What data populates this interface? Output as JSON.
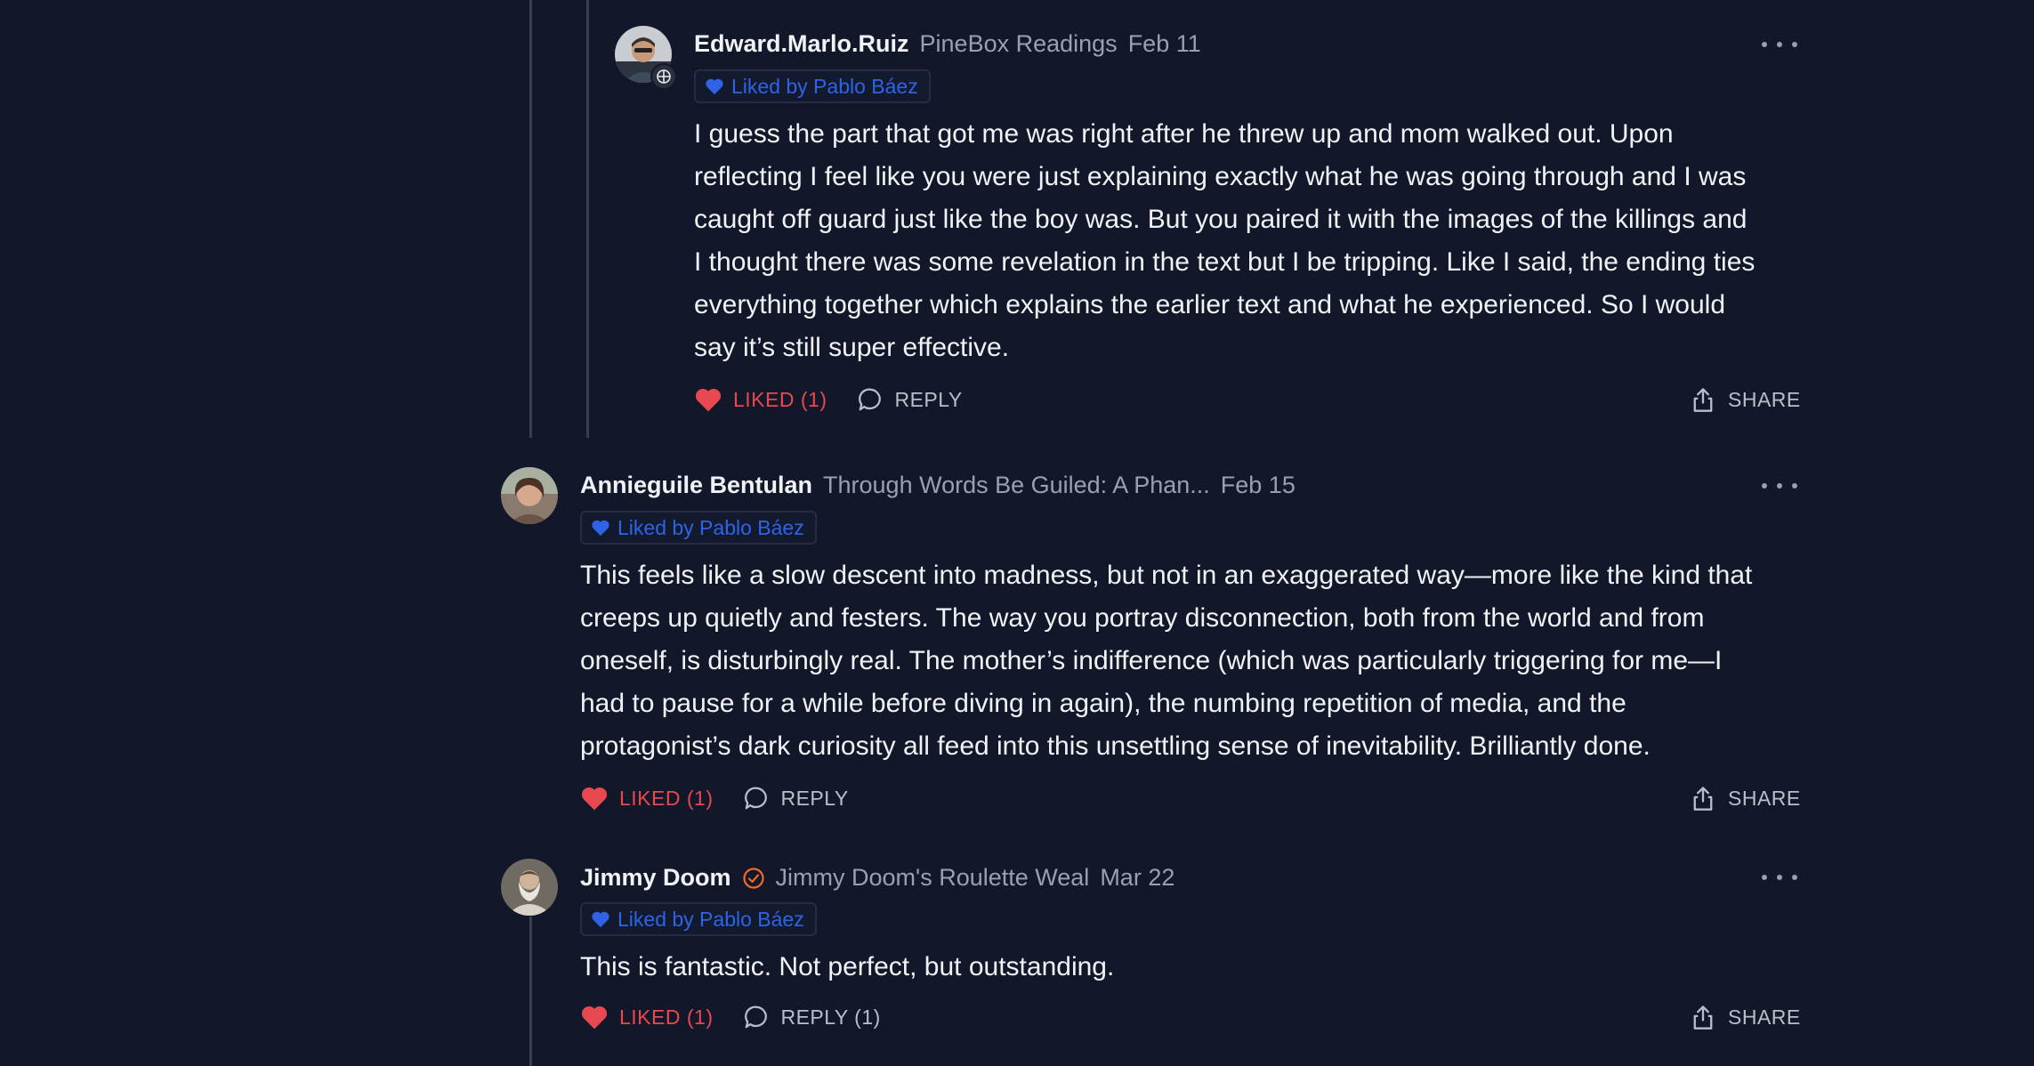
{
  "colors": {
    "background": "#121829",
    "liked_red": "#e8484f",
    "badge_blue": "#2e63e8",
    "verified_orange": "#f06a2a"
  },
  "comments": [
    {
      "author": "Edward.Marlo.Ruiz",
      "publication": "PineBox Readings",
      "date": "Feb 11",
      "liked_by": "Liked by Pablo Báez",
      "lines": [
        "I guess the part that got me was right after he threw up and mom walked out. Upon",
        "reflecting I feel like you were just explaining exactly what he was going through and I was",
        "caught off guard just like the boy was. But you paired it with the images of the killings and",
        "I thought there was some revelation in the text but I be tripping. Like I said, the ending ties",
        "everything together which explains the earlier text and what he experienced. So I would",
        "say it’s still super effective."
      ],
      "like_label": "LIKED (1)",
      "reply_label": "REPLY",
      "share_label": "SHARE",
      "avatar_icon": "user-avatar-with-badge"
    },
    {
      "author": "Annieguile Bentulan",
      "publication": "Through Words Be Guiled: A Phan...",
      "date": "Feb 15",
      "liked_by": "Liked by Pablo Báez",
      "lines": [
        "This feels like a slow descent into madness, but not in an exaggerated way—more like the kind that",
        "creeps up quietly and festers. The way you portray disconnection, both from the world and from",
        "oneself, is disturbingly real. The mother’s indifference (which was particularly triggering for me—I",
        "had to pause for a while before diving in again), the numbing repetition of media, and the",
        "protagonist’s dark curiosity all feed into this unsettling sense of inevitability. Brilliantly done."
      ],
      "like_label": "LIKED (1)",
      "reply_label": "REPLY",
      "share_label": "SHARE",
      "avatar_icon": "user-avatar"
    },
    {
      "author": "Jimmy Doom",
      "verified_icon": "verified-check-icon",
      "publication": "Jimmy Doom's Roulette Weal",
      "date": "Mar 22",
      "liked_by": "Liked by Pablo Báez",
      "lines": [
        "This is fantastic. Not perfect, but outstanding."
      ],
      "like_label": "LIKED (1)",
      "reply_label": "REPLY (1)",
      "share_label": "SHARE",
      "avatar_icon": "user-avatar"
    }
  ]
}
